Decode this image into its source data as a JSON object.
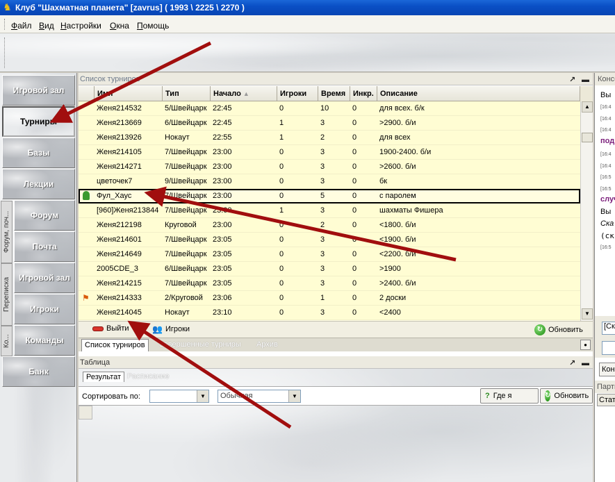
{
  "window": {
    "title": "Клуб \"Шахматная планета\" [zavrus]  ( 1993 \\ 2225 \\ 2270 )"
  },
  "menu": [
    {
      "label": "Файл",
      "u": "Ф",
      "rest": "айл"
    },
    {
      "label": "Вид",
      "u": "В",
      "rest": "ид"
    },
    {
      "label": "Настройки",
      "u": "Н",
      "rest": "астройки"
    },
    {
      "label": "Окна",
      "u": "О",
      "rest": "кна"
    },
    {
      "label": "Помощь",
      "u": "П",
      "rest": "омощь"
    }
  ],
  "nav": {
    "items": [
      "Игровой зал",
      "Турниры",
      "Базы",
      "Лекции",
      "Форум",
      "Почта",
      "Игровой зал",
      "Игроки",
      "Команды",
      "Банк"
    ],
    "vtabs": [
      "Форум, поч...",
      "Переписка",
      "Ко..."
    ],
    "active": "Турниры"
  },
  "tournaments": {
    "panel_title": "Список турниров",
    "columns": [
      "Имя",
      "Тип",
      "Начало",
      "Игроки",
      "Время",
      "Инкр.",
      "Описание"
    ],
    "sort_column": "Начало",
    "rows": [
      {
        "icon": "",
        "name": "Женя214532",
        "type": "5/Швейцарк",
        "start": "22:45",
        "players": "0",
        "time": "10",
        "inc": "0",
        "desc": "для всех. б/к"
      },
      {
        "icon": "",
        "name": "Женя213669",
        "type": "6/Швейцарк",
        "start": "22:45",
        "players": "1",
        "time": "3",
        "inc": "0",
        "desc": ">2900. б/и"
      },
      {
        "icon": "",
        "name": "Женя213926",
        "type": "Нокаут",
        "start": "22:55",
        "players": "1",
        "time": "2",
        "inc": "0",
        "desc": "для всех"
      },
      {
        "icon": "",
        "name": "Женя214105",
        "type": "7/Швейцарк",
        "start": "23:00",
        "players": "0",
        "time": "3",
        "inc": "0",
        "desc": "1900-2400. б/и"
      },
      {
        "icon": "",
        "name": "Женя214271",
        "type": "7/Швейцарк",
        "start": "23:00",
        "players": "0",
        "time": "3",
        "inc": "0",
        "desc": ">2600. б/и"
      },
      {
        "icon": "",
        "name": "цветочек7",
        "type": "9/Швейцарк",
        "start": "23:00",
        "players": "0",
        "time": "3",
        "inc": "0",
        "desc": "бк"
      },
      {
        "icon": "user-icon",
        "name": "Фул_Хаус",
        "type": "7/Швейцарк",
        "start": "23:00",
        "players": "0",
        "time": "5",
        "inc": "0",
        "desc": "с паролем",
        "selected": true
      },
      {
        "icon": "",
        "name": "[960]Женя213844",
        "type": "7/Швейцарк",
        "start": "23:00",
        "players": "1",
        "time": "3",
        "inc": "0",
        "desc": "шахматы Фишера"
      },
      {
        "icon": "",
        "name": "Женя212198",
        "type": "Круговой",
        "start": "23:00",
        "players": "0",
        "time": "2",
        "inc": "0",
        "desc": "<1800. б/и"
      },
      {
        "icon": "",
        "name": "Женя214601",
        "type": "7/Швейцарк",
        "start": "23:05",
        "players": "0",
        "time": "3",
        "inc": "0",
        "desc": "<1900. б/и"
      },
      {
        "icon": "",
        "name": "Женя214649",
        "type": "7/Швейцарк",
        "start": "23:05",
        "players": "0",
        "time": "3",
        "inc": "0",
        "desc": "<2200. б/и"
      },
      {
        "icon": "",
        "name": "2005CDE_3",
        "type": "6/Швейцарк",
        "start": "23:05",
        "players": "0",
        "time": "3",
        "inc": "0",
        "desc": ">1900"
      },
      {
        "icon": "",
        "name": "Женя214215",
        "type": "7/Швейцарк",
        "start": "23:05",
        "players": "0",
        "time": "3",
        "inc": "0",
        "desc": ">2400. б/и"
      },
      {
        "icon": "flag-icon",
        "name": "Женя214333",
        "type": "2/Круговой",
        "start": "23:06",
        "players": "0",
        "time": "1",
        "inc": "0",
        "desc": "2 доски"
      },
      {
        "icon": "",
        "name": "Женя214045",
        "type": "Нокаут",
        "start": "23:10",
        "players": "0",
        "time": "3",
        "inc": "0",
        "desc": "<2400"
      }
    ],
    "actions": {
      "exit": "Выйти",
      "players": "Игроки",
      "refresh": "Обновить"
    },
    "tabs": [
      "Список турниров",
      "Завершенные турниры",
      "Архив"
    ]
  },
  "table": {
    "panel_title": "Таблица",
    "tabs": [
      "Результат",
      "Расписание"
    ],
    "sort_label": "Сортировать по:",
    "sort_value": "",
    "mode_value": "Обычная",
    "where_button": "Где я",
    "refresh": "Обновить"
  },
  "right": {
    "title": "Консо",
    "lines": [
      "Вы",
      "[16:4",
      "[16:4",
      "[16:4",
      "подв",
      "[16:4",
      "[16:4",
      "[16:5",
      "[16:5",
      "случ",
      "Вы",
      "Ска",
      "(ск",
      "[16:5"
    ],
    "input": "[Ск",
    "button": "Кон",
    "bottom_title": "Парти",
    "bottom_tab": "Стат"
  },
  "colors": {
    "titlebar": "#0a4fc5",
    "row_bg": "#fffdd3",
    "arrow": "#a10e0e"
  }
}
